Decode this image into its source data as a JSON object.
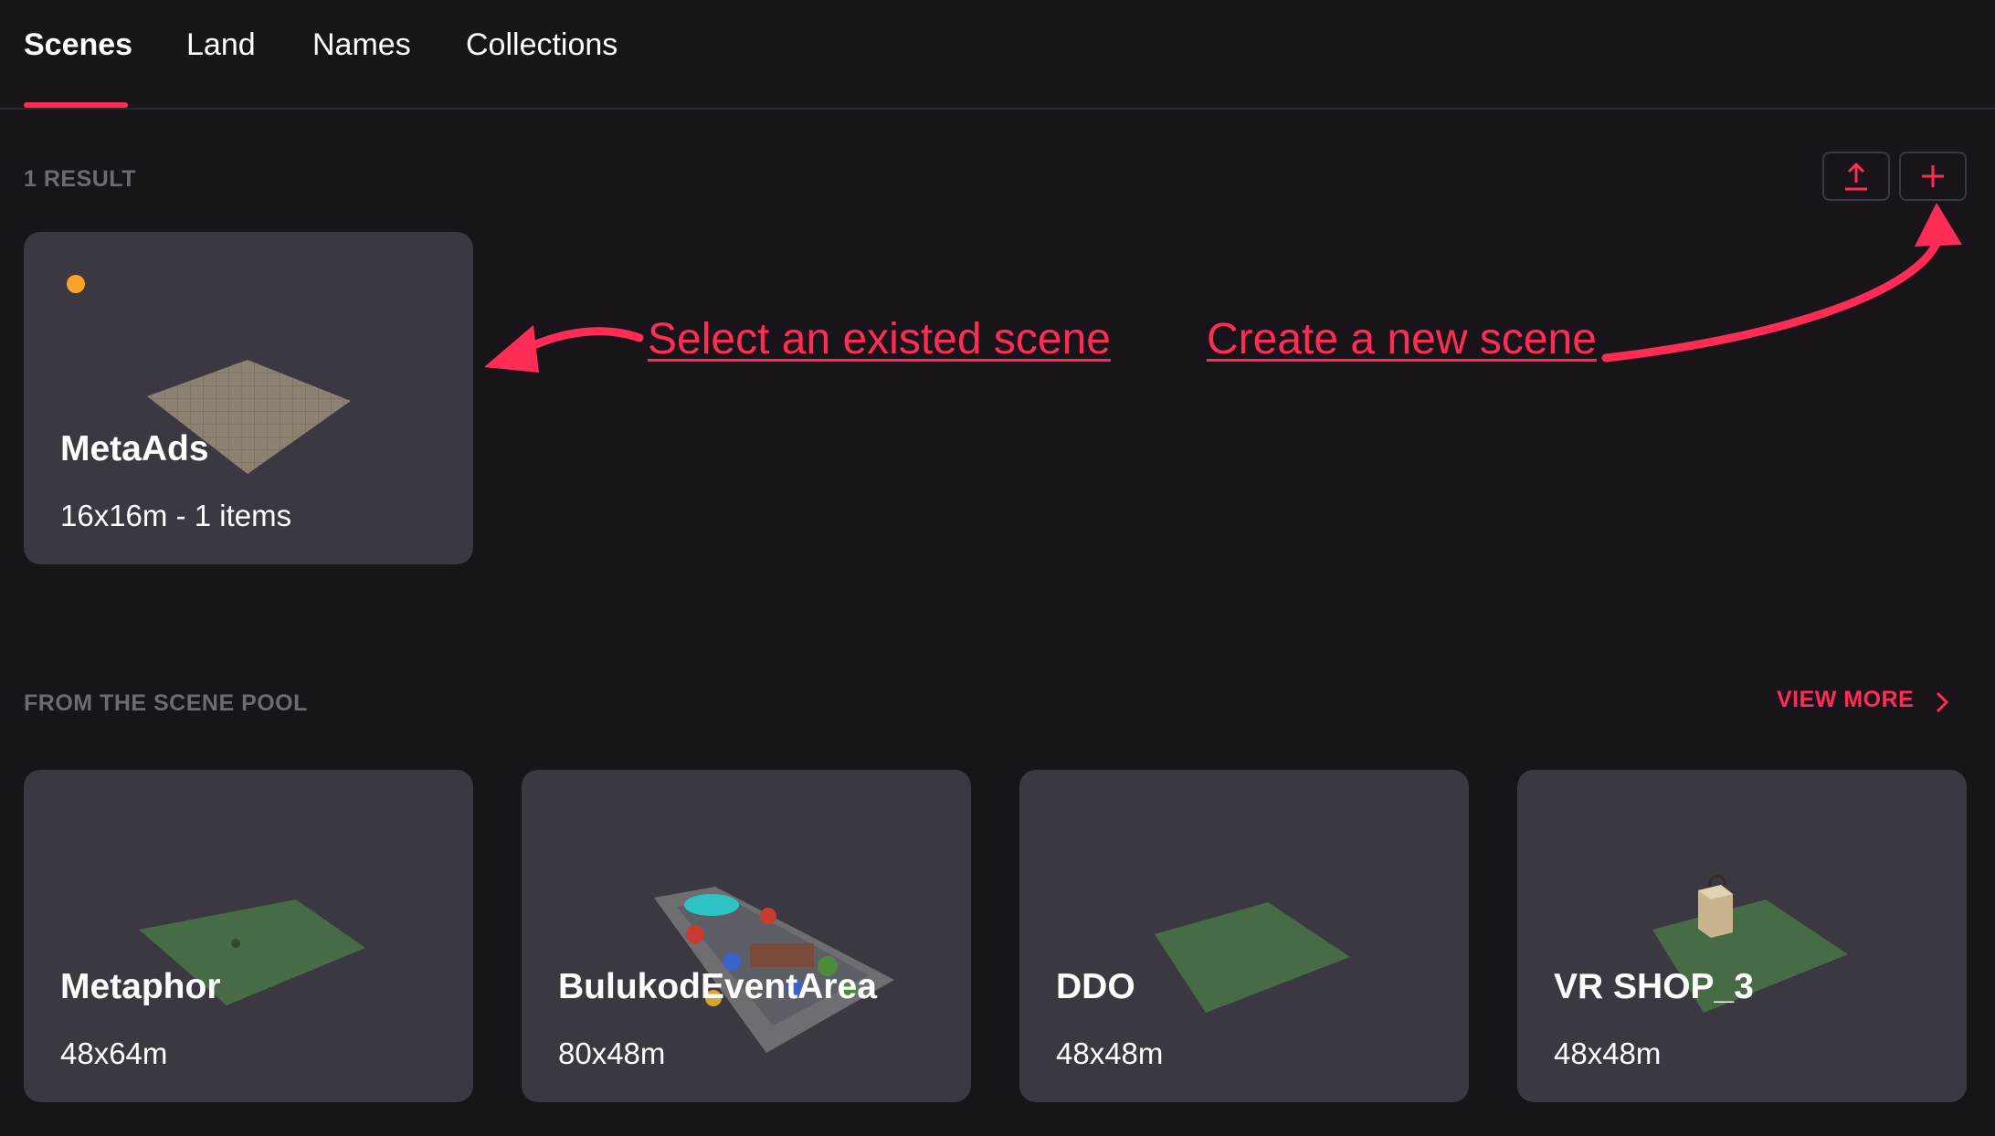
{
  "tabs": [
    {
      "label": "Scenes",
      "active": true
    },
    {
      "label": "Land",
      "active": false
    },
    {
      "label": "Names",
      "active": false
    },
    {
      "label": "Collections",
      "active": false
    }
  ],
  "results": {
    "count_label": "1 RESULT",
    "actions": [
      {
        "icon": "upload-icon"
      },
      {
        "icon": "plus-icon"
      }
    ]
  },
  "my_scenes": [
    {
      "title": "MetaAds",
      "subtitle": "16x16m - 1 items",
      "status_color": "#ffa228"
    }
  ],
  "annotations": {
    "select": "Select an existed scene",
    "create": "Create a new scene"
  },
  "scene_pool": {
    "label": "FROM THE SCENE POOL",
    "view_more": "VIEW MORE",
    "items": [
      {
        "title": "Metaphor",
        "subtitle": "48x64m"
      },
      {
        "title": "BulukodEventArea",
        "subtitle": "80x48m"
      },
      {
        "title": "DDO",
        "subtitle": "48x48m"
      },
      {
        "title": "VR SHOP_3",
        "subtitle": "48x48m"
      }
    ]
  },
  "colors": {
    "background": "#18141a",
    "card": "#3b3842",
    "accent": "#ff2d55",
    "muted_label": "#6e6a74",
    "status_dot": "#ffa228"
  }
}
